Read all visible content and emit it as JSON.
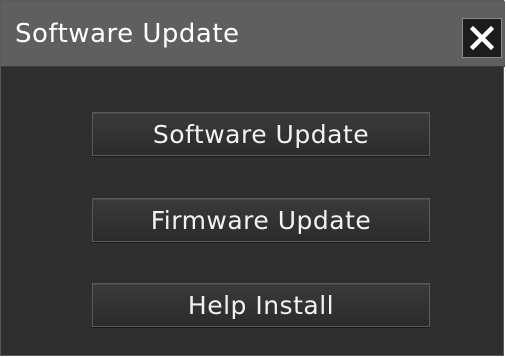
{
  "dialog": {
    "title": "Software Update",
    "close_icon": "close-icon"
  },
  "buttons": [
    {
      "label": "Software Update"
    },
    {
      "label": "Firmware Update"
    },
    {
      "label": "Help Install"
    }
  ],
  "colors": {
    "titlebar": "#5f5f5f",
    "body": "#2f2f2f",
    "button": "#333333",
    "text": "#ffffff"
  }
}
